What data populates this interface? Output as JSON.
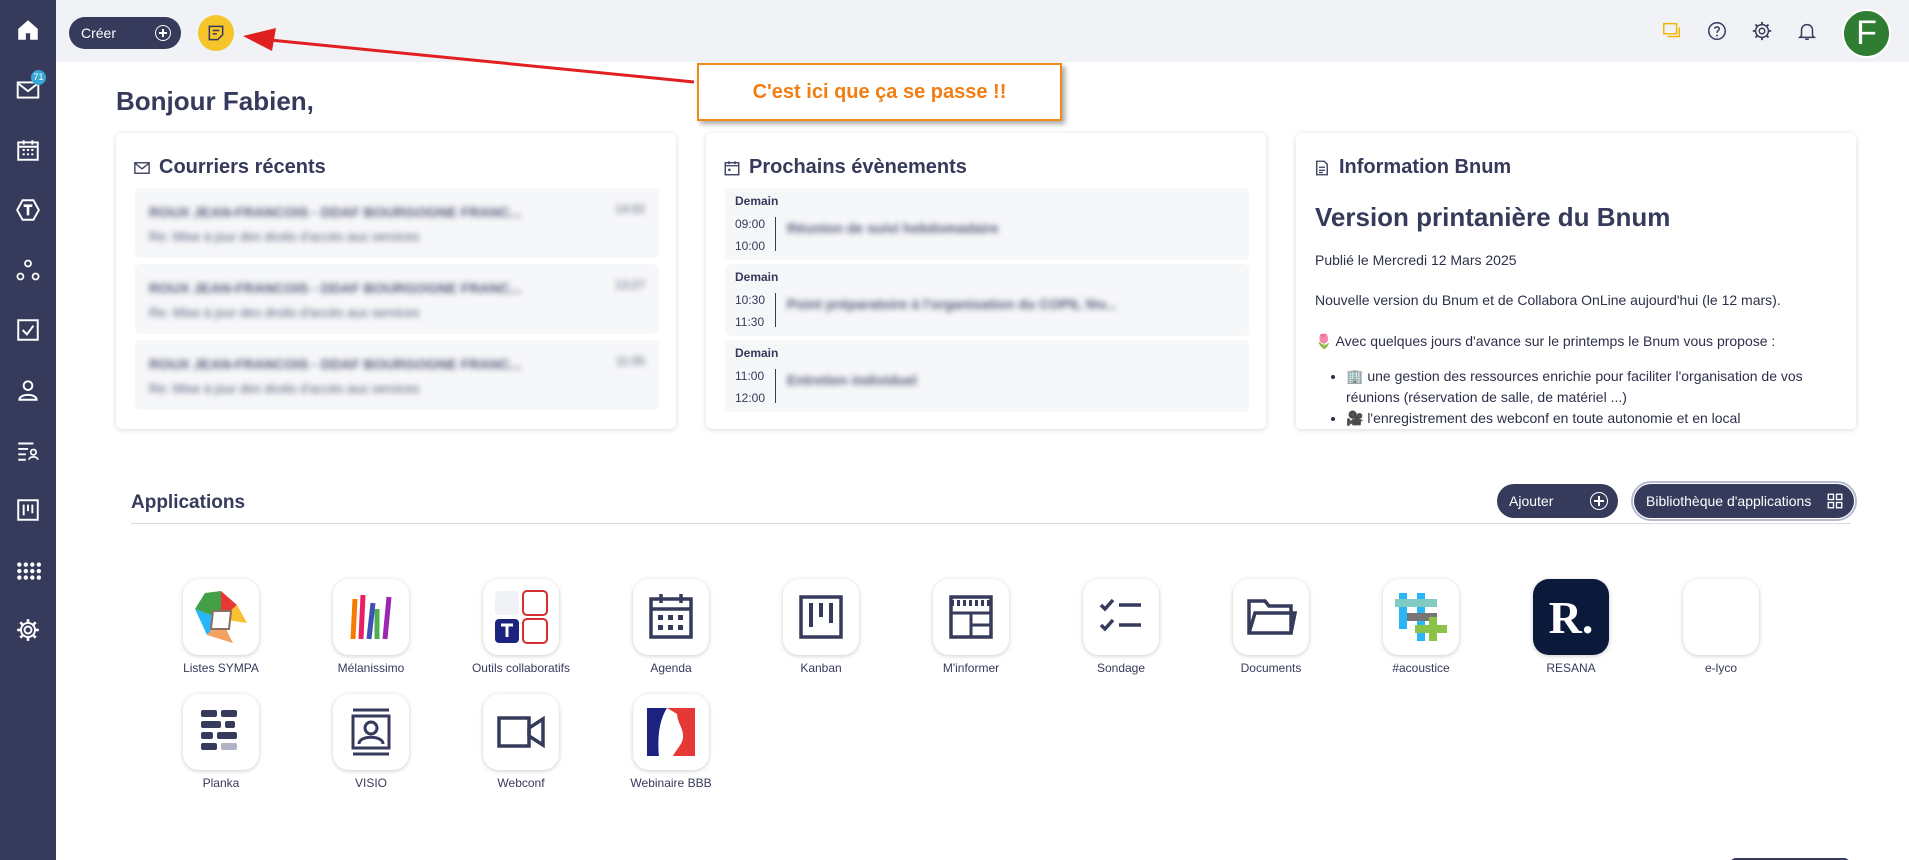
{
  "sidebar": {
    "items": [
      {
        "icon": "home-icon"
      },
      {
        "icon": "mail-icon",
        "badge": "71"
      },
      {
        "icon": "calendar-icon"
      },
      {
        "icon": "tchap-icon"
      },
      {
        "icon": "workspaces-icon"
      },
      {
        "icon": "tasks-icon"
      },
      {
        "icon": "contacts-icon"
      },
      {
        "icon": "directory-icon"
      },
      {
        "icon": "kanban-icon"
      },
      {
        "icon": "apps-grid-icon"
      },
      {
        "icon": "settings-icon"
      }
    ]
  },
  "topbar": {
    "create_label": "Créer",
    "avatar_initial": "F"
  },
  "annotation": {
    "callout_text": "C'est ici que ça se passe !!"
  },
  "greeting": "Bonjour Fabien,",
  "mail_card": {
    "title": "Courriers récents",
    "items": [
      {
        "from": "ROUX JEAN-FRANCOIS - DDAF BOURGOGNE FRANC...",
        "date": "14:02",
        "subject": "Re: Mise à jour des droits d'accès aux services"
      },
      {
        "from": "ROUX JEAN-FRANCOIS - DDAF BOURGOGNE FRANC...",
        "date": "13:27",
        "subject": "Re: Mise à jour des droits d'accès aux services"
      },
      {
        "from": "ROUX JEAN-FRANCOIS - DDAF BOURGOGNE FRANC...",
        "date": "11:05",
        "subject": "Re: Mise à jour des droits d'accès aux services"
      }
    ]
  },
  "events_card": {
    "title": "Prochains évènements",
    "items": [
      {
        "day": "Demain",
        "start": "09:00",
        "end": "10:00",
        "title": "Réunion de suivi hebdomadaire"
      },
      {
        "day": "Demain",
        "start": "10:30",
        "end": "11:30",
        "title": "Point préparatoire à l'organisation du COPIL fév..."
      },
      {
        "day": "Demain",
        "start": "11:00",
        "end": "12:00",
        "title": "Entretien individuel"
      }
    ]
  },
  "info_card": {
    "title": "Information Bnum",
    "heading": "Version printanière du Bnum",
    "published": "Publié le Mercredi 12 Mars 2025",
    "para1": "Nouvelle version du Bnum et de Collabora OnLine aujourd'hui (le 12 mars).",
    "para2": "🌷 Avec quelques jours d'avance sur le printemps le Bnum vous propose :",
    "bullets": [
      "🏢 une gestion des ressources enrichie pour faciliter l'organisation de vos réunions (réservation de salle, de matériel ...)",
      "🎥 l'enregistrement des webconf en toute autonomie et en local"
    ]
  },
  "apps": {
    "title": "Applications",
    "add_label": "Ajouter",
    "library_label": "Bibliothèque d'applications",
    "list": [
      {
        "label": "Listes SYMPA",
        "icon": "sympa-icon"
      },
      {
        "label": "Mélanissimo",
        "icon": "melanissimo-icon"
      },
      {
        "label": "Outils collaboratifs",
        "icon": "outils-collaboratifs-icon"
      },
      {
        "label": "Agenda",
        "icon": "agenda-icon"
      },
      {
        "label": "Kanban",
        "icon": "kanban-app-icon"
      },
      {
        "label": "M'informer",
        "icon": "news-icon"
      },
      {
        "label": "Sondage",
        "icon": "poll-icon"
      },
      {
        "label": "Documents",
        "icon": "folder-icon"
      },
      {
        "label": "#acoustice",
        "icon": "acoustice-icon"
      },
      {
        "label": "RESANA",
        "icon": "resana-icon",
        "tile_text": "R."
      },
      {
        "label": "e-lyco",
        "icon": "elyco-icon"
      },
      {
        "label": "Planka",
        "icon": "planka-icon"
      },
      {
        "label": "VISIO",
        "icon": "visio-icon"
      },
      {
        "label": "Webconf",
        "icon": "webconf-icon"
      },
      {
        "label": "Webinaire BBB",
        "icon": "marianne-icon"
      }
    ]
  },
  "colors": {
    "sidebar": "#363a5b",
    "topbar": "#f1f2f5",
    "notes": "#f5c52b",
    "avatar": "#2f7d32",
    "annotation": "#f08a1c"
  }
}
